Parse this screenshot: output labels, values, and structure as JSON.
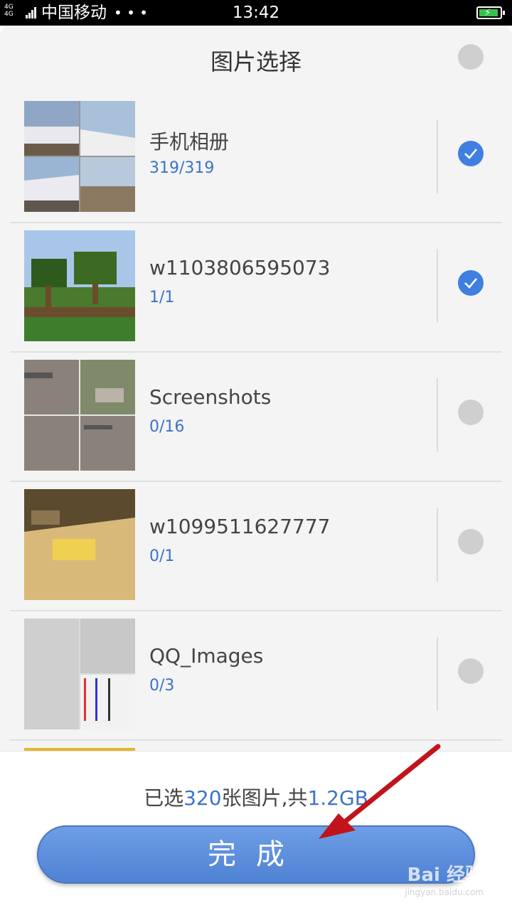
{
  "status_bar": {
    "network": "4G 4G",
    "carrier": "中国移动",
    "more": "• • •",
    "time": "13:42"
  },
  "dialog": {
    "title": "图片选择"
  },
  "albums": [
    {
      "name": "手机相册",
      "count": "319/319",
      "selected": true
    },
    {
      "name": "w1103806595073",
      "count": "1/1",
      "selected": true
    },
    {
      "name": "Screenshots",
      "count": "0/16",
      "selected": false
    },
    {
      "name": "w1099511627777",
      "count": "0/1",
      "selected": false
    },
    {
      "name": "QQ_Images",
      "count": "0/3",
      "selected": false
    }
  ],
  "footer": {
    "summary_prefix": "已选",
    "selected_count": "320",
    "summary_mid": "张图片,共",
    "total_size": "1.2GB",
    "done_label": "完成"
  },
  "watermark": {
    "brand": "Bai 经验",
    "url": "jingyan.baidu.com"
  },
  "colors": {
    "accent": "#3b73c7",
    "check_on": "#3f7fe0",
    "button": "#5b8bd9",
    "arrow": "#c0141c"
  }
}
